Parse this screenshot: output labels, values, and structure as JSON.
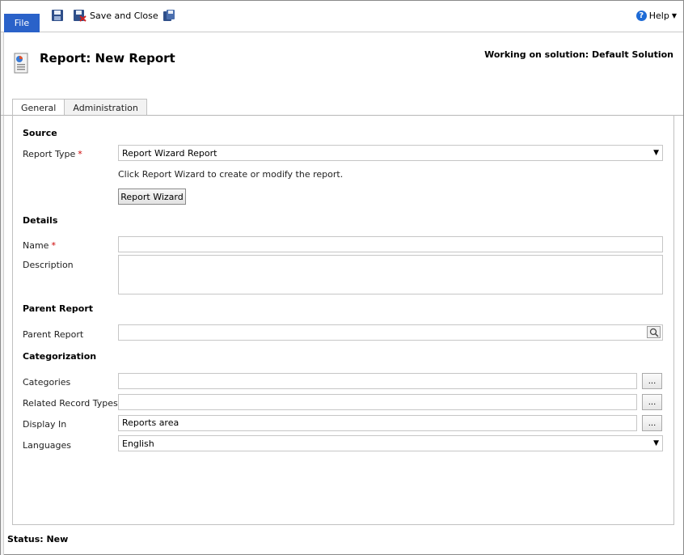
{
  "ribbon": {
    "file_label": "File",
    "save_close_label": "Save and Close",
    "help_label": "Help",
    "icons": [
      "save-icon",
      "save-close-icon",
      "save-as-icon",
      "help-icon"
    ]
  },
  "header": {
    "title": "Report: New Report",
    "solution": "Working on solution: Default Solution"
  },
  "tabs": [
    {
      "label": "General"
    },
    {
      "label": "Administration"
    }
  ],
  "form": {
    "source": {
      "heading": "Source",
      "report_type_label": "Report Type",
      "report_type_value": "Report Wizard Report",
      "hint": "Click Report Wizard to create or modify the report.",
      "wizard_button": "Report Wizard"
    },
    "details": {
      "heading": "Details",
      "name_label": "Name",
      "name_value": "",
      "description_label": "Description",
      "description_value": ""
    },
    "parent": {
      "heading": "Parent Report",
      "parent_label": "Parent Report",
      "parent_value": ""
    },
    "categorization": {
      "heading": "Categorization",
      "categories_label": "Categories",
      "categories_value": "",
      "related_label": "Related Record Types",
      "related_value": "",
      "display_label": "Display In",
      "display_value": "Reports area",
      "languages_label": "Languages",
      "languages_value": "English",
      "dots": "..."
    },
    "required_marker": "*"
  },
  "status": "Status: New",
  "colors": {
    "file_tab": "#2a62c9",
    "required": "#cc0000",
    "help_icon": "#1e6bd6"
  }
}
